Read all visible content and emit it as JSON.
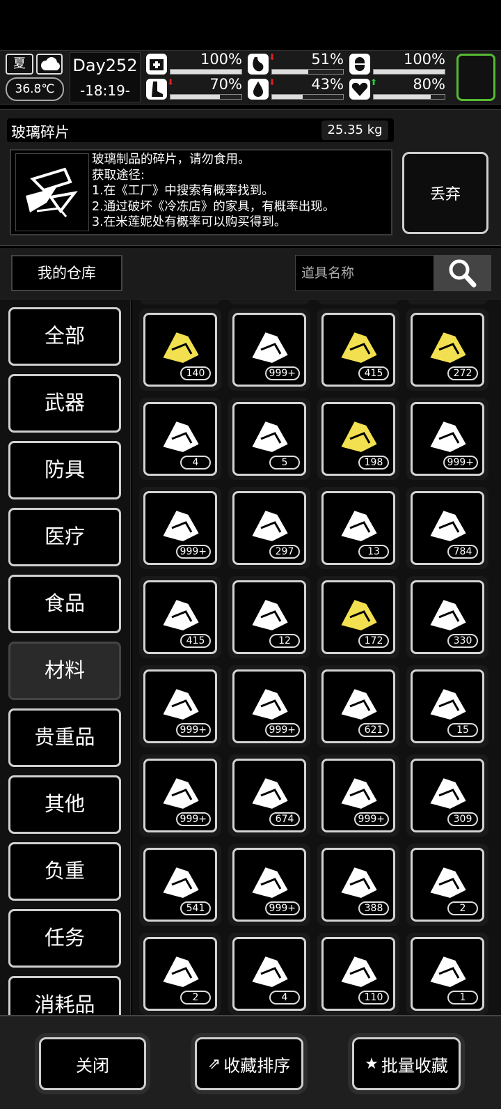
{
  "status": {
    "season": "夏",
    "temperature": "36.8℃",
    "day": "Day252",
    "time": "-18:19-",
    "stats": [
      {
        "name": "health",
        "value": "100%",
        "level": 1.0,
        "trend": ""
      },
      {
        "name": "hunger",
        "value": "51%",
        "level": 0.51,
        "trend": "down"
      },
      {
        "name": "mood",
        "value": "100%",
        "level": 1.0,
        "trend": ""
      },
      {
        "name": "stamina",
        "value": "70%",
        "level": 0.7,
        "trend": "down"
      },
      {
        "name": "thirst",
        "value": "43%",
        "level": 0.43,
        "trend": "down"
      },
      {
        "name": "heart",
        "value": "80%",
        "level": 0.8,
        "trend": "up"
      }
    ]
  },
  "detail": {
    "item_name": "玻璃碎片",
    "weight": "25.35 kg",
    "description": [
      "玻璃制品的碎片，请勿食用。",
      "获取途径:",
      "1.在《工厂》中搜索有概率找到。",
      "2.通过破坏《冷冻店》的家具，有概率出现。",
      "3.在米莲妮处有概率可以购买得到。"
    ],
    "discard_label": "丢弃"
  },
  "search": {
    "warehouse_label": "我的仓库",
    "placeholder": "道具名称"
  },
  "categories": [
    "全部",
    "武器",
    "防具",
    "医疗",
    "食品",
    "材料",
    "贵重品",
    "其他",
    "负重",
    "任务",
    "消耗品"
  ],
  "active_category": "材料",
  "items": [
    {
      "icon": "flask-icon",
      "count": "140",
      "highlight": true
    },
    {
      "icon": "barrel-icon",
      "count": "999+",
      "highlight": false
    },
    {
      "icon": "cloth-icon",
      "count": "415",
      "highlight": true
    },
    {
      "icon": "fabric-strips-icon",
      "count": "272",
      "highlight": true
    },
    {
      "icon": "broken-gun-icon",
      "count": "4",
      "highlight": false
    },
    {
      "icon": "pipe-icon",
      "count": "5",
      "highlight": false
    },
    {
      "icon": "mechanical-parts-icon",
      "count": "198",
      "highlight": true
    },
    {
      "icon": "log-icon",
      "count": "999+",
      "highlight": false
    },
    {
      "icon": "rock-icon",
      "count": "999+",
      "highlight": false
    },
    {
      "icon": "glass-shard-icon",
      "count": "297",
      "highlight": false
    },
    {
      "icon": "sack-icon",
      "count": "13",
      "highlight": false
    },
    {
      "icon": "fur-icon",
      "count": "784",
      "highlight": false
    },
    {
      "icon": "bricks-icon",
      "count": "415",
      "highlight": false
    },
    {
      "icon": "leather-icon",
      "count": "12",
      "highlight": false
    },
    {
      "icon": "nuggets-icon",
      "count": "172",
      "highlight": true
    },
    {
      "icon": "spray-bottle-icon",
      "count": "330",
      "highlight": false
    },
    {
      "icon": "beaker-icon",
      "count": "999+",
      "highlight": false
    },
    {
      "icon": "gravel-icon",
      "count": "999+",
      "highlight": false
    },
    {
      "icon": "tape-icon",
      "count": "621",
      "highlight": false
    },
    {
      "icon": "bag-icon",
      "count": "15",
      "highlight": false
    },
    {
      "icon": "scrap-metal-icon",
      "count": "999+",
      "highlight": false
    },
    {
      "icon": "cotton-balls-icon",
      "count": "674",
      "highlight": false
    },
    {
      "icon": "metal-plate-icon",
      "count": "999+",
      "highlight": false
    },
    {
      "icon": "bullet-icon",
      "count": "309",
      "highlight": false
    },
    {
      "icon": "battery-icon",
      "count": "541",
      "highlight": false
    },
    {
      "icon": "towels-icon",
      "count": "999+",
      "highlight": false
    },
    {
      "icon": "soldering-iron-icon",
      "count": "388",
      "highlight": false
    },
    {
      "icon": "handle-icon",
      "count": "2",
      "highlight": false
    },
    {
      "icon": "gun-parts-icon",
      "count": "2",
      "highlight": false
    },
    {
      "icon": "tire-icon",
      "count": "4",
      "highlight": false
    },
    {
      "icon": "plastic-bottle-icon",
      "count": "110",
      "highlight": false
    },
    {
      "icon": "engine-part-icon",
      "count": "1",
      "highlight": false
    }
  ],
  "bottom": {
    "close_label": "关闭",
    "sort_label": "收藏排序",
    "batch_label": "批量收藏"
  },
  "colors": {
    "highlight": "#f2e050",
    "portrait_border": "#55bb33",
    "down_arrow": "#e02020",
    "up_arrow": "#20d040"
  }
}
